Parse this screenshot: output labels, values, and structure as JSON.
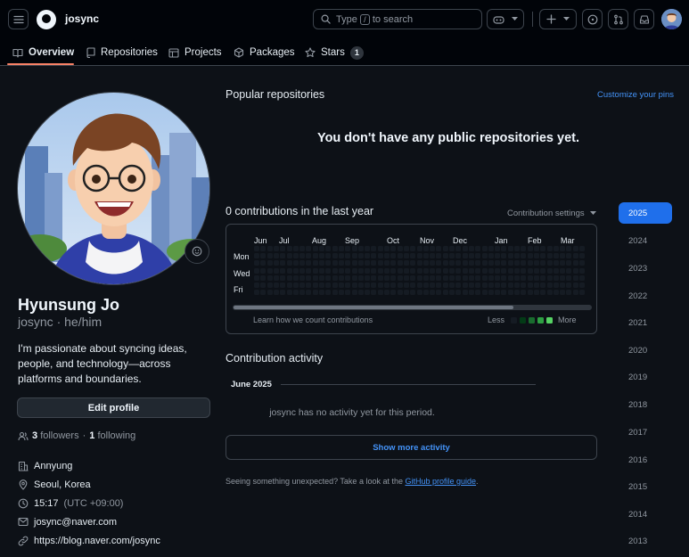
{
  "header": {
    "brand": "josync",
    "search": {
      "prefix": "Type",
      "key": "/",
      "suffix": "to search"
    }
  },
  "tabs": [
    {
      "label": "Overview",
      "active": true
    },
    {
      "label": "Repositories"
    },
    {
      "label": "Projects"
    },
    {
      "label": "Packages"
    },
    {
      "label": "Stars",
      "count": "1"
    }
  ],
  "profile": {
    "name": "Hyunsung Jo",
    "login": "josync · he/him",
    "bio": "I'm passionate about syncing ideas, people, and technology—across platforms and boundaries.",
    "edit_label": "Edit profile",
    "followers_count": "3",
    "followers_label": "followers",
    "following_count": "1",
    "following_label": "following",
    "organization": "Annyung",
    "location": "Seoul, Korea",
    "time": "15:17",
    "timezone": "(UTC +09:00)",
    "email": "josync@naver.com",
    "website": "https://blog.naver.com/josync"
  },
  "popular": {
    "title": "Popular repositories",
    "customize_label": "Customize your pins",
    "empty_message": "You don't have any public repositories yet."
  },
  "contributions": {
    "title": "0 contributions in the last year",
    "settings_label": "Contribution settings",
    "months": [
      "Jun",
      "Jul",
      "Aug",
      "Sep",
      "Oct",
      "Nov",
      "Dec",
      "Jan",
      "Feb",
      "Mar"
    ],
    "days": [
      "Mon",
      "Wed",
      "Fri"
    ],
    "learn_label": "Learn how we count contributions",
    "less_label": "Less",
    "more_label": "More",
    "level_colors": [
      "#151b23",
      "#033a16",
      "#196c2e",
      "#2ea043",
      "#56d364"
    ]
  },
  "activity": {
    "title": "Contribution activity",
    "month": "June 2025",
    "empty_message": "josync has no activity yet for this period.",
    "show_more_label": "Show more activity",
    "footnote_prefix": "Seeing something unexpected? Take a look at the",
    "footnote_link": "GitHub profile guide",
    "footnote_suffix": "."
  },
  "years": [
    "2025",
    "2024",
    "2023",
    "2022",
    "2021",
    "2020",
    "2019",
    "2018",
    "2017",
    "2016",
    "2015",
    "2014",
    "2013"
  ],
  "selected_year": "2025"
}
